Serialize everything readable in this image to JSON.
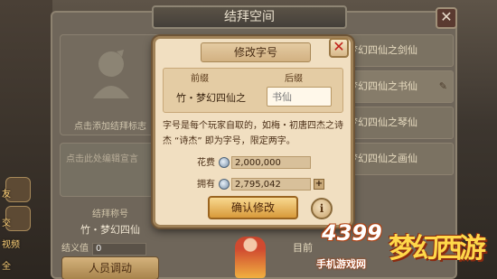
{
  "main_panel": {
    "title": "结拜空间",
    "avatar_label": "点击添加结拜标志",
    "message_placeholder": "点击此处编辑宣言",
    "title_label": "结拜称号",
    "title_value": "竹・梦幻四仙",
    "loyalty_label": "结义值",
    "loyalty_value": "0",
    "transfer_button": "人员调动",
    "members": [
      {
        "name": "梦幻四仙之剑仙",
        "highlight": false,
        "editable": false
      },
      {
        "name": "梦幻四仙之书仙",
        "highlight": true,
        "editable": true
      },
      {
        "name": "梦幻四仙之琴仙",
        "highlight": false,
        "editable": false
      },
      {
        "name": "梦幻四仙之画仙",
        "highlight": false,
        "editable": false
      }
    ],
    "bottom_text": "目前"
  },
  "side": {
    "label_top": "友",
    "label_mid": "交",
    "label_bottom_1": "视频",
    "label_bottom_2": "全"
  },
  "dialog": {
    "title": "修改字号",
    "prefix_header": "前缀",
    "suffix_header": "后缀",
    "prefix_value": "竹・梦幻四仙之",
    "suffix_placeholder": "书仙",
    "description": "字号是每个玩家自取的，如梅・初唐四杰之诗杰 “诗杰” 即为字号，限定两字。",
    "cost_label": "花费",
    "cost_value": "2,000,000",
    "owned_label": "拥有",
    "owned_value": "2,795,042",
    "confirm_button": "确认修改",
    "info_button": "i",
    "close_button": "✕"
  },
  "watermark": {
    "number": "4399",
    "site": "手机游戏网",
    "logo": "梦幻西游"
  },
  "icons": {
    "coin": "silver-coin-icon",
    "plus": "plus-icon",
    "close": "close-icon",
    "pencil": "pencil-icon",
    "info": "info-icon"
  },
  "colors": {
    "dialog_bg": "#f1dfc1",
    "confirm_button": "#e0a848",
    "close_x": "#c0201a"
  }
}
